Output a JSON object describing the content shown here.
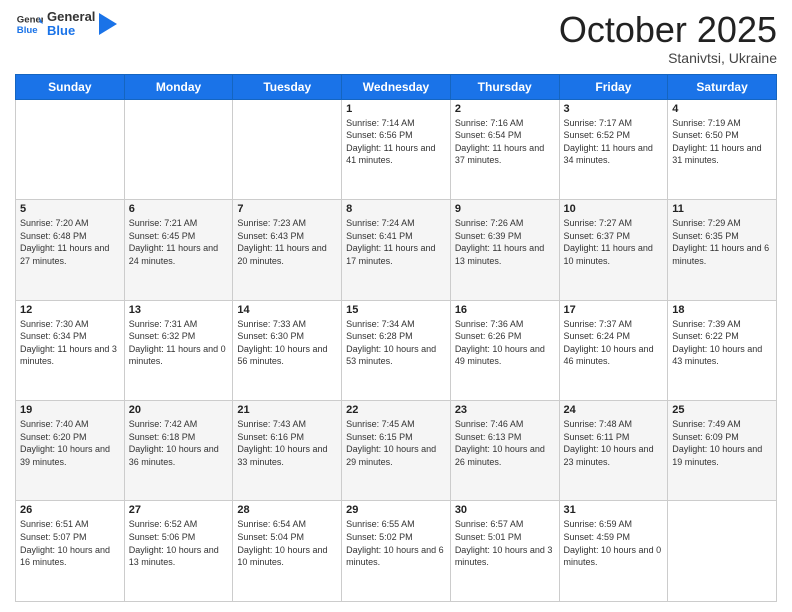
{
  "header": {
    "logo_general": "General",
    "logo_blue": "Blue",
    "month": "October 2025",
    "location": "Stanivtsi, Ukraine"
  },
  "weekdays": [
    "Sunday",
    "Monday",
    "Tuesday",
    "Wednesday",
    "Thursday",
    "Friday",
    "Saturday"
  ],
  "weeks": [
    [
      {
        "day": "",
        "sunrise": "",
        "sunset": "",
        "daylight": ""
      },
      {
        "day": "",
        "sunrise": "",
        "sunset": "",
        "daylight": ""
      },
      {
        "day": "",
        "sunrise": "",
        "sunset": "",
        "daylight": ""
      },
      {
        "day": "1",
        "sunrise": "Sunrise: 7:14 AM",
        "sunset": "Sunset: 6:56 PM",
        "daylight": "Daylight: 11 hours and 41 minutes."
      },
      {
        "day": "2",
        "sunrise": "Sunrise: 7:16 AM",
        "sunset": "Sunset: 6:54 PM",
        "daylight": "Daylight: 11 hours and 37 minutes."
      },
      {
        "day": "3",
        "sunrise": "Sunrise: 7:17 AM",
        "sunset": "Sunset: 6:52 PM",
        "daylight": "Daylight: 11 hours and 34 minutes."
      },
      {
        "day": "4",
        "sunrise": "Sunrise: 7:19 AM",
        "sunset": "Sunset: 6:50 PM",
        "daylight": "Daylight: 11 hours and 31 minutes."
      }
    ],
    [
      {
        "day": "5",
        "sunrise": "Sunrise: 7:20 AM",
        "sunset": "Sunset: 6:48 PM",
        "daylight": "Daylight: 11 hours and 27 minutes."
      },
      {
        "day": "6",
        "sunrise": "Sunrise: 7:21 AM",
        "sunset": "Sunset: 6:45 PM",
        "daylight": "Daylight: 11 hours and 24 minutes."
      },
      {
        "day": "7",
        "sunrise": "Sunrise: 7:23 AM",
        "sunset": "Sunset: 6:43 PM",
        "daylight": "Daylight: 11 hours and 20 minutes."
      },
      {
        "day": "8",
        "sunrise": "Sunrise: 7:24 AM",
        "sunset": "Sunset: 6:41 PM",
        "daylight": "Daylight: 11 hours and 17 minutes."
      },
      {
        "day": "9",
        "sunrise": "Sunrise: 7:26 AM",
        "sunset": "Sunset: 6:39 PM",
        "daylight": "Daylight: 11 hours and 13 minutes."
      },
      {
        "day": "10",
        "sunrise": "Sunrise: 7:27 AM",
        "sunset": "Sunset: 6:37 PM",
        "daylight": "Daylight: 11 hours and 10 minutes."
      },
      {
        "day": "11",
        "sunrise": "Sunrise: 7:29 AM",
        "sunset": "Sunset: 6:35 PM",
        "daylight": "Daylight: 11 hours and 6 minutes."
      }
    ],
    [
      {
        "day": "12",
        "sunrise": "Sunrise: 7:30 AM",
        "sunset": "Sunset: 6:34 PM",
        "daylight": "Daylight: 11 hours and 3 minutes."
      },
      {
        "day": "13",
        "sunrise": "Sunrise: 7:31 AM",
        "sunset": "Sunset: 6:32 PM",
        "daylight": "Daylight: 11 hours and 0 minutes."
      },
      {
        "day": "14",
        "sunrise": "Sunrise: 7:33 AM",
        "sunset": "Sunset: 6:30 PM",
        "daylight": "Daylight: 10 hours and 56 minutes."
      },
      {
        "day": "15",
        "sunrise": "Sunrise: 7:34 AM",
        "sunset": "Sunset: 6:28 PM",
        "daylight": "Daylight: 10 hours and 53 minutes."
      },
      {
        "day": "16",
        "sunrise": "Sunrise: 7:36 AM",
        "sunset": "Sunset: 6:26 PM",
        "daylight": "Daylight: 10 hours and 49 minutes."
      },
      {
        "day": "17",
        "sunrise": "Sunrise: 7:37 AM",
        "sunset": "Sunset: 6:24 PM",
        "daylight": "Daylight: 10 hours and 46 minutes."
      },
      {
        "day": "18",
        "sunrise": "Sunrise: 7:39 AM",
        "sunset": "Sunset: 6:22 PM",
        "daylight": "Daylight: 10 hours and 43 minutes."
      }
    ],
    [
      {
        "day": "19",
        "sunrise": "Sunrise: 7:40 AM",
        "sunset": "Sunset: 6:20 PM",
        "daylight": "Daylight: 10 hours and 39 minutes."
      },
      {
        "day": "20",
        "sunrise": "Sunrise: 7:42 AM",
        "sunset": "Sunset: 6:18 PM",
        "daylight": "Daylight: 10 hours and 36 minutes."
      },
      {
        "day": "21",
        "sunrise": "Sunrise: 7:43 AM",
        "sunset": "Sunset: 6:16 PM",
        "daylight": "Daylight: 10 hours and 33 minutes."
      },
      {
        "day": "22",
        "sunrise": "Sunrise: 7:45 AM",
        "sunset": "Sunset: 6:15 PM",
        "daylight": "Daylight: 10 hours and 29 minutes."
      },
      {
        "day": "23",
        "sunrise": "Sunrise: 7:46 AM",
        "sunset": "Sunset: 6:13 PM",
        "daylight": "Daylight: 10 hours and 26 minutes."
      },
      {
        "day": "24",
        "sunrise": "Sunrise: 7:48 AM",
        "sunset": "Sunset: 6:11 PM",
        "daylight": "Daylight: 10 hours and 23 minutes."
      },
      {
        "day": "25",
        "sunrise": "Sunrise: 7:49 AM",
        "sunset": "Sunset: 6:09 PM",
        "daylight": "Daylight: 10 hours and 19 minutes."
      }
    ],
    [
      {
        "day": "26",
        "sunrise": "Sunrise: 6:51 AM",
        "sunset": "Sunset: 5:07 PM",
        "daylight": "Daylight: 10 hours and 16 minutes."
      },
      {
        "day": "27",
        "sunrise": "Sunrise: 6:52 AM",
        "sunset": "Sunset: 5:06 PM",
        "daylight": "Daylight: 10 hours and 13 minutes."
      },
      {
        "day": "28",
        "sunrise": "Sunrise: 6:54 AM",
        "sunset": "Sunset: 5:04 PM",
        "daylight": "Daylight: 10 hours and 10 minutes."
      },
      {
        "day": "29",
        "sunrise": "Sunrise: 6:55 AM",
        "sunset": "Sunset: 5:02 PM",
        "daylight": "Daylight: 10 hours and 6 minutes."
      },
      {
        "day": "30",
        "sunrise": "Sunrise: 6:57 AM",
        "sunset": "Sunset: 5:01 PM",
        "daylight": "Daylight: 10 hours and 3 minutes."
      },
      {
        "day": "31",
        "sunrise": "Sunrise: 6:59 AM",
        "sunset": "Sunset: 4:59 PM",
        "daylight": "Daylight: 10 hours and 0 minutes."
      },
      {
        "day": "",
        "sunrise": "",
        "sunset": "",
        "daylight": ""
      }
    ]
  ]
}
